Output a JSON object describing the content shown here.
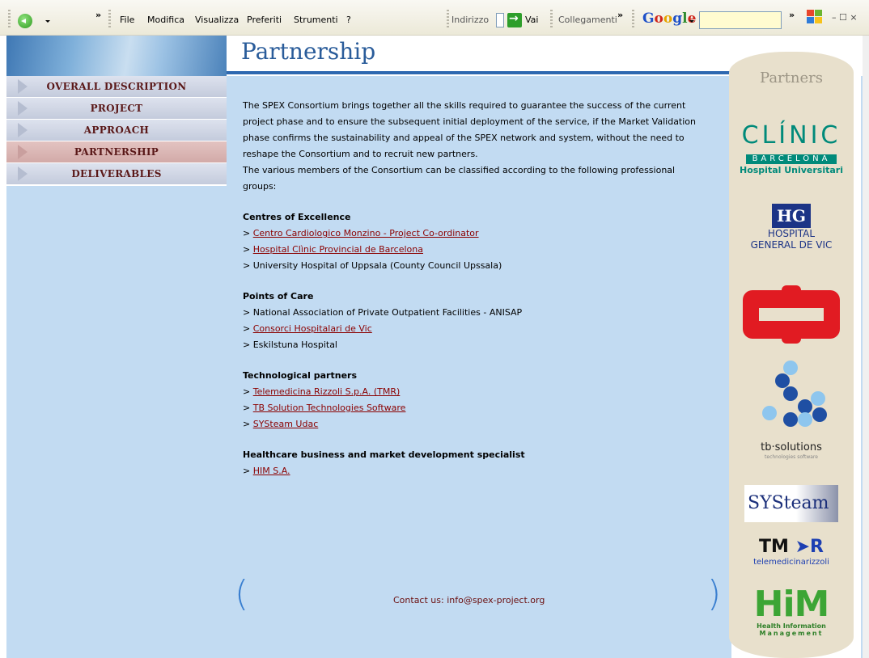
{
  "toolbar": {
    "chevron_1": "»",
    "menu": [
      "File",
      "Modifica",
      "Visualizza",
      "Preferiti",
      "Strumenti",
      "?"
    ],
    "address_label": "Indirizzo",
    "go_label": "Vai",
    "links_label": "Collegamenti",
    "chevron_2": "»",
    "google_label": "Google",
    "chevron_3": "»",
    "window_controls": "– ☐ ×"
  },
  "nav": {
    "items": [
      {
        "label": "OVERALL DESCRIPTION",
        "active": false
      },
      {
        "label": "PROJECT",
        "active": false
      },
      {
        "label": "APPROACH",
        "active": false
      },
      {
        "label": "PARTNERSHIP",
        "active": true
      },
      {
        "label": "DELIVERABLES",
        "active": false
      }
    ]
  },
  "page": {
    "title": "Partnership",
    "intro": [
      "The SPEX Consortium brings together all the skills required to guarantee the success of the current project phase and to ensure the subsequent initial deployment of the service, if the Market Validation phase confirms the sustainability and appeal of the SPEX network and system, without the need to reshape the Consortium and to recruit new partners.",
      "The various members of the Consortium can be classified according to the following professional groups:"
    ],
    "groups": [
      {
        "title": "Centres of Excellence",
        "items": [
          {
            "prefix": "> ",
            "text": "Centro Cardiologico Monzino - Project Co-ordinator",
            "link": true
          },
          {
            "prefix": "> ",
            "text": "Hospital Clìnic Provincial de Barcelona",
            "link": true
          },
          {
            "prefix": "> ",
            "text": "University Hospital of Uppsala (County Council Upssala)",
            "link": false
          }
        ]
      },
      {
        "title": "Points of Care",
        "items": [
          {
            "prefix": "> ",
            "text": "National Association of Private Outpatient Facilities - ANISAP",
            "link": false
          },
          {
            "prefix": "> ",
            "text": "Consorci Hospitalari de Vic",
            "link": true
          },
          {
            "prefix": "> ",
            "text": "Eskilstuna Hospital",
            "link": false
          }
        ]
      },
      {
        "title": "Technological partners",
        "items": [
          {
            "prefix": "> ",
            "text": "Telemedicina Rizzoli S.p.A. (TMR)",
            "link": true
          },
          {
            "prefix": "> ",
            "text": "TB Solution Technologies Software",
            "link": true
          },
          {
            "prefix": "> ",
            "text": "SYSteam Udac",
            "link": true
          }
        ]
      },
      {
        "title": "Healthcare business and market development specialist",
        "items": [
          {
            "prefix": "> ",
            "text": "HIM S.A.",
            "link": true
          }
        ]
      }
    ],
    "contact": "Contact us: info@spex-project.org",
    "paren_left": "(",
    "paren_right": ")"
  },
  "partners": {
    "title": "Partners",
    "clinic": {
      "name": "CLÍNIC",
      "city": "BARCELONA",
      "sub": "Hospital Universitari"
    },
    "hg": {
      "mark": "HG",
      "line1": "HOSPITAL",
      "line2": "GENERAL DE VIC"
    },
    "tb": {
      "name": "tb·solutions",
      "tag": "technologies software"
    },
    "systeam": {
      "name": "SYSteam"
    },
    "tmr": {
      "mark": "TM",
      "mark_r": "R",
      "sub": "telemedicinarizzoli"
    },
    "him": {
      "mark": "HiM",
      "line1": "Health Information",
      "line2": "Management"
    }
  },
  "colors": {
    "content_bg": "#c2dbf2",
    "title": "#2a5c9a",
    "link": "#8b0000",
    "nav_text": "#5a1818",
    "partners_bg": "#e8e0cc"
  }
}
